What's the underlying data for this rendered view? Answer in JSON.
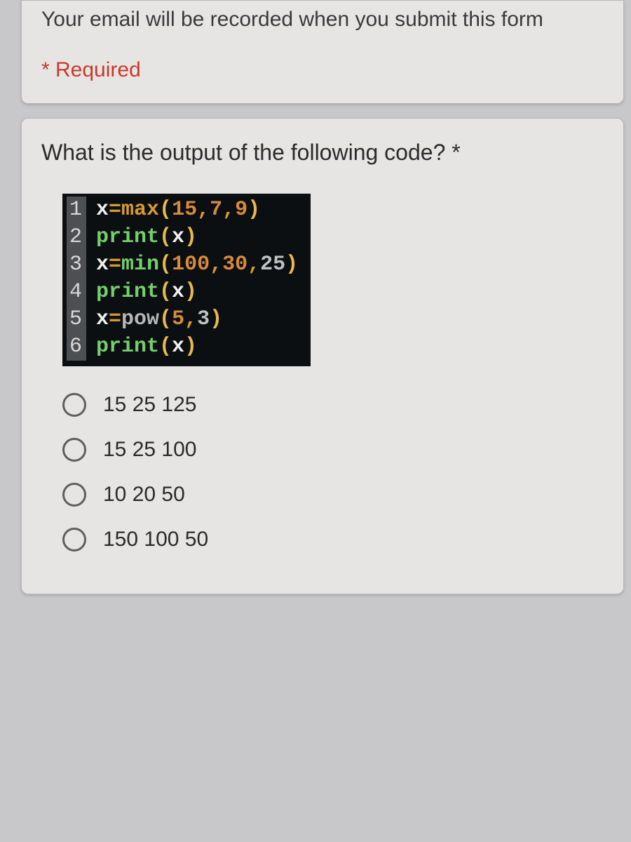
{
  "header": {
    "email_notice": "Your email will be recorded when you submit this form",
    "required_label": "* Required"
  },
  "question": {
    "prompt": "What is the output of the following code? *",
    "code_lines": [
      {
        "n": "1",
        "html": "x=max(15,7,9)"
      },
      {
        "n": "2",
        "html": "print(x)"
      },
      {
        "n": "3",
        "html": "x=min(100,30,25)"
      },
      {
        "n": "4",
        "html": "print(x)"
      },
      {
        "n": "5",
        "html": "x=pow(5,3)"
      },
      {
        "n": "6",
        "html": "print(x)"
      }
    ],
    "options": [
      "15 25 125",
      "15 25 100",
      "10 20 50",
      "150 100 50"
    ]
  }
}
